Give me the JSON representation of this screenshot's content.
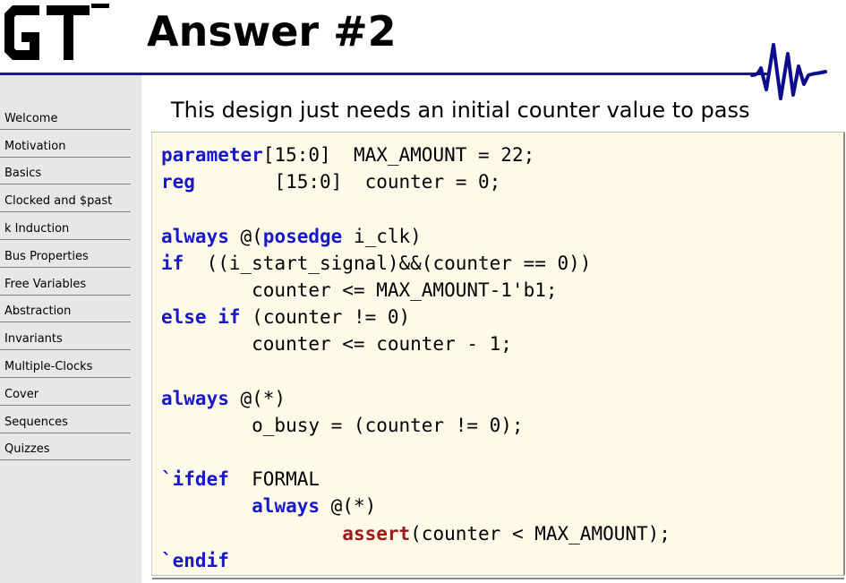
{
  "header": {
    "title": "Answer #2",
    "logo_icon": "gt-logo-icon",
    "wave_icon": "waveform-icon"
  },
  "sidebar": {
    "items": [
      {
        "label": "Welcome"
      },
      {
        "label": "Motivation"
      },
      {
        "label": "Basics"
      },
      {
        "label": "Clocked and $past"
      },
      {
        "label": "k Induction"
      },
      {
        "label": "Bus Properties"
      },
      {
        "label": "Free Variables"
      },
      {
        "label": "Abstraction"
      },
      {
        "label": "Invariants"
      },
      {
        "label": "Multiple-Clocks"
      },
      {
        "label": "Cover"
      },
      {
        "label": "Sequences"
      },
      {
        "label": "Quizzes"
      }
    ]
  },
  "main": {
    "subtitle": "This design just needs an initial counter value to pass"
  },
  "code": [
    [
      {
        "t": "parameter",
        "c": "kw"
      },
      {
        "t": "[15:0]  MAX_AMOUNT = 22;",
        "c": ""
      }
    ],
    [
      {
        "t": "reg",
        "c": "kw"
      },
      {
        "t": "       [15:0]  counter = 0;",
        "c": ""
      }
    ],
    [],
    [
      {
        "t": "always",
        "c": "kw"
      },
      {
        "t": " @(",
        "c": ""
      },
      {
        "t": "posedge",
        "c": "kw"
      },
      {
        "t": " i_clk)",
        "c": ""
      }
    ],
    [
      {
        "t": "if",
        "c": "kw"
      },
      {
        "t": "  ((i_start_signal)&&(counter == 0))",
        "c": ""
      }
    ],
    [
      {
        "t": "        counter <= MAX_AMOUNT-1'b1;",
        "c": ""
      }
    ],
    [
      {
        "t": "else",
        "c": "kw"
      },
      {
        "t": " ",
        "c": ""
      },
      {
        "t": "if",
        "c": "kw"
      },
      {
        "t": " (counter != 0)",
        "c": ""
      }
    ],
    [
      {
        "t": "        counter <= counter - 1;",
        "c": ""
      }
    ],
    [],
    [
      {
        "t": "always",
        "c": "kw"
      },
      {
        "t": " @(*)",
        "c": ""
      }
    ],
    [
      {
        "t": "        o_busy = (counter != 0);",
        "c": ""
      }
    ],
    [],
    [
      {
        "t": "`ifdef",
        "c": "kw"
      },
      {
        "t": "  FORMAL",
        "c": ""
      }
    ],
    [
      {
        "t": "        ",
        "c": ""
      },
      {
        "t": "always",
        "c": "kw"
      },
      {
        "t": " @(*)",
        "c": ""
      }
    ],
    [
      {
        "t": "                ",
        "c": ""
      },
      {
        "t": "assert",
        "c": "as"
      },
      {
        "t": "(counter < MAX_AMOUNT);",
        "c": ""
      }
    ],
    [
      {
        "t": "`endif",
        "c": "kw"
      }
    ]
  ],
  "colors": {
    "keyword": "#1818c8",
    "assert": "#a01818",
    "header_rule": "#1a1a8c",
    "code_background": "#fefae8",
    "sidebar_background": "#e7e7e7"
  }
}
